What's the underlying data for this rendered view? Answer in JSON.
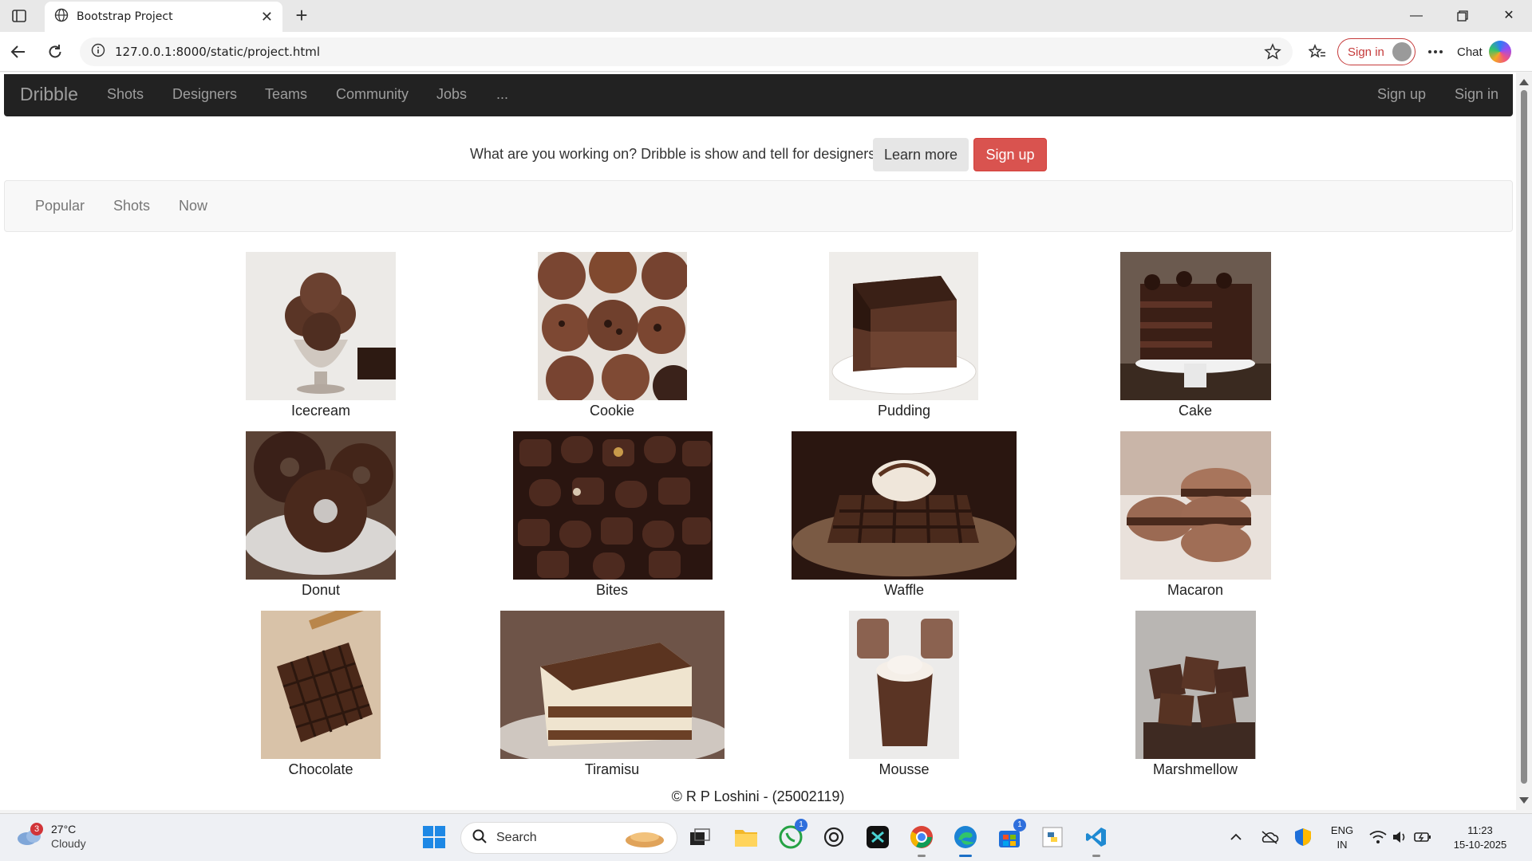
{
  "browser": {
    "tab_title": "Bootstrap Project",
    "url": "127.0.0.1:8000/static/project.html",
    "signin_label": "Sign in",
    "chat_label": "Chat"
  },
  "navbar": {
    "brand": "Dribble",
    "links": [
      "Shots",
      "Designers",
      "Teams",
      "Community",
      "Jobs",
      "..."
    ],
    "right_links": [
      "Sign up",
      "Sign in"
    ]
  },
  "promo": {
    "text": "What are you working on? Dribble is show and tell for designers.",
    "learn_more": "Learn more",
    "sign_up": "Sign up"
  },
  "subnav": {
    "links": [
      "Popular",
      "Shots",
      "Now"
    ]
  },
  "gallery": [
    {
      "caption": "Icecream",
      "icon": "icecream-photo"
    },
    {
      "caption": "Cookie",
      "icon": "cookie-photo"
    },
    {
      "caption": "Pudding",
      "icon": "pudding-photo"
    },
    {
      "caption": "Cake",
      "icon": "cake-photo"
    },
    {
      "caption": "Donut",
      "icon": "donut-photo"
    },
    {
      "caption": "Bites",
      "icon": "bites-photo"
    },
    {
      "caption": "Waffle",
      "icon": "waffle-photo"
    },
    {
      "caption": "Macaron",
      "icon": "macaron-photo"
    },
    {
      "caption": "Chocolate",
      "icon": "chocolate-photo"
    },
    {
      "caption": "Tiramisu",
      "icon": "tiramisu-photo"
    },
    {
      "caption": "Mousse",
      "icon": "mousse-photo"
    },
    {
      "caption": "Marshmellow",
      "icon": "marshmellow-photo"
    }
  ],
  "footer": "© R P Loshini - (25002119)",
  "taskbar": {
    "weather_temp": "27°C",
    "weather_desc": "Cloudy",
    "weather_badge": "3",
    "search_label": "Search",
    "whatsapp_badge": "1",
    "store_badge": "1",
    "lang_line1": "ENG",
    "lang_line2": "IN",
    "time": "11:23",
    "date": "15-10-2025"
  },
  "colors": {
    "navbar_bg": "#222222",
    "signup_red": "#d9534f",
    "chocolate_dark": "#3b2418"
  }
}
